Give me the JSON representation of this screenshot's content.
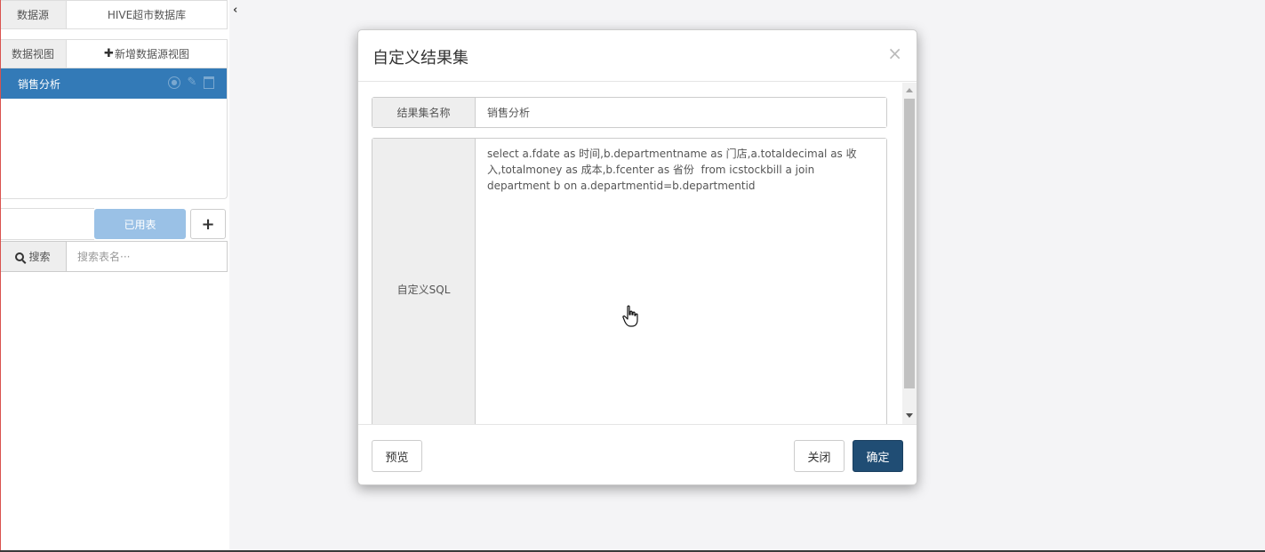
{
  "sidebar": {
    "datasource_label": "数据源",
    "datasource_value": "HIVE超市数据库",
    "dataview_label": "数据视图",
    "add_view_plus": "✚",
    "add_view_label": "新增数据源视图",
    "views": [
      {
        "label": "销售分析",
        "selected": true
      }
    ],
    "tab_used_label": "已用表",
    "tab_add_label": "+",
    "search_label": "搜索",
    "search_placeholder": "搜索表名···",
    "collapse_glyph": "‹"
  },
  "modal": {
    "title": "自定义结果集",
    "close_glyph": "×",
    "name_label": "结果集名称",
    "name_value": "销售分析",
    "sql_label": "自定义SQL",
    "sql_value": "select a.fdate as 时间,b.departmentname as 门店,a.totaldecimal as 收入,totalmoney as 成本,b.fcenter as 省份  from icstockbill a join department b on a.departmentid=b.departmentid",
    "preview_button": "预览",
    "close_button": "关闭",
    "confirm_button": "确定"
  },
  "colors": {
    "selected_item": "#337ab7",
    "used_tab": "#9ac1e6",
    "primary_button": "#204d74"
  }
}
